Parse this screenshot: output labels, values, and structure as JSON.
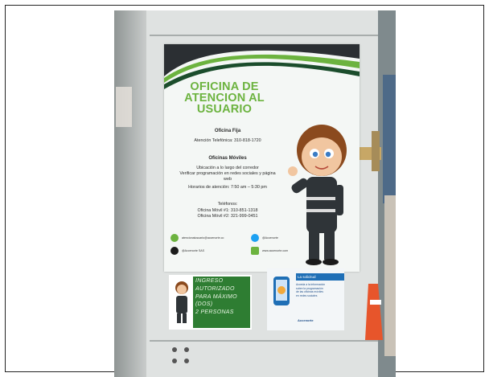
{
  "poster": {
    "title_lines": [
      "OFICINA DE",
      "ATENCION AL",
      "USUARIO"
    ],
    "fixed_heading": "Oficina Fija",
    "fixed_phone": "Atención Telefónica: 310-818-1720",
    "mobile_heading": "Oficinas Móviles",
    "mobile_lines": [
      "Ubicación a lo largo del corredor",
      "Verificar programación en redes sociales y página",
      "web",
      "Horarios de atención: 7:50 am – 5:30 pm"
    ],
    "phones_heading": "Teléfonos:",
    "phones": [
      "Oficina Móvil #1: 310-851-1318",
      "Oficina Móvil #2: 321-999-0451"
    ],
    "contacts": {
      "email": "atencionalusuario@accenorte.co",
      "twitter": "@Accenorte",
      "facebook": "@Accenorte SAS",
      "web": "www.accenorte.com"
    }
  },
  "sticker_left": {
    "lines": [
      "INGRESO",
      "AUTORIZADO",
      "PARA MÁXIMO",
      "(DOS)",
      "2 PERSONAS"
    ]
  },
  "sticker_right": {
    "title": "La solicitud",
    "lines": [
      "Acceda a la información",
      "sobre la programación",
      "de las oficinas móviles",
      "en redes sociales"
    ],
    "footer": "Accenorte"
  },
  "colors": {
    "brand_green": "#6cb33f",
    "dark_green": "#2e7d32",
    "blue": "#1f6fb6"
  }
}
